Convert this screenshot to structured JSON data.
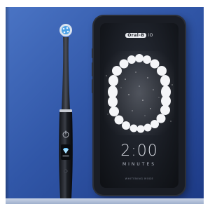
{
  "phone": {
    "brand_logo": "Oral-B",
    "brand_suffix": "iO",
    "timer": "2:00",
    "timer_unit": "MINUTES",
    "mode_label": "WHITENING MODE"
  },
  "colors": {
    "background_blue": "#3157a8",
    "device_black": "#1a1d24",
    "bristle_blue": "#4aa0e6",
    "diamond_display": "#6cc6ff"
  },
  "icons": {
    "power": "power-icon",
    "mode": "diamond-icon"
  }
}
